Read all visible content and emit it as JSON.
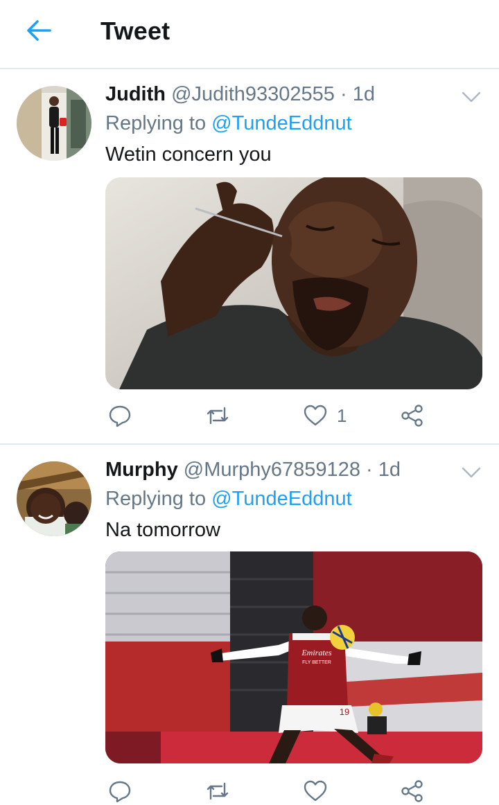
{
  "header": {
    "title": "Tweet",
    "back_icon": "arrow-left-icon"
  },
  "colors": {
    "accent": "#1da1f2",
    "secondary_text": "#657786",
    "primary_text": "#14171a",
    "divider": "#e1e8ed"
  },
  "tweets": [
    {
      "name": "Judith",
      "handle": "@Judith93302555",
      "sep": "·",
      "time": "1d",
      "replying_label": "Replying to",
      "replying_to": "@TundeEddnut",
      "text": "Wetin concern you",
      "actions": {
        "reply_count": "",
        "retweet_count": "",
        "like_count": "1"
      }
    },
    {
      "name": "Murphy",
      "handle": "@Murphy67859128",
      "sep": "·",
      "time": "1d",
      "replying_label": "Replying to",
      "replying_to": "@TundeEddnut",
      "text": "Na tomorrow",
      "media_text": {
        "sponsor": "Emirates",
        "tagline": "FLY BETTER",
        "number": "19"
      },
      "actions": {
        "reply_count": "",
        "retweet_count": "",
        "like_count": ""
      }
    }
  ]
}
